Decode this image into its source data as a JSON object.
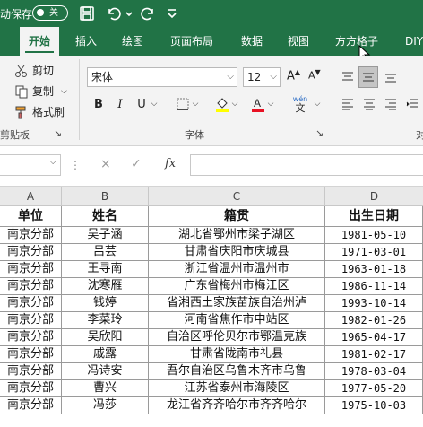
{
  "qat": {
    "autosave_label": "动保存",
    "toggle_label": "关"
  },
  "tabs": [
    "开始",
    "插入",
    "绘图",
    "页面布局",
    "数据",
    "视图",
    "方方格子",
    "DIY"
  ],
  "clipboard": {
    "cut": "剪切",
    "copy": "复制",
    "format_painter": "格式刷",
    "group": "剪贴板"
  },
  "font": {
    "name": "宋体",
    "size": "12",
    "group": "字体",
    "bold": "B",
    "italic": "I",
    "underline": "U",
    "pinyin_top": "wén",
    "pinyin_bottom": "文"
  },
  "align": {
    "group_partial": "对"
  },
  "formula": {
    "fx": "fx",
    "cancel": "×",
    "confirm": "✓"
  },
  "columns": [
    "A",
    "B",
    "C",
    "D"
  ],
  "table": {
    "headers": [
      "单位",
      "姓名",
      "籍贯",
      "出生日期"
    ],
    "rows": [
      [
        "南京分部",
        "吴子涵",
        "湖北省鄂州市梁子湖区",
        "1981-05-10"
      ],
      [
        "南京分部",
        "吕芸",
        "甘肃省庆阳市庆城县",
        "1971-03-01"
      ],
      [
        "南京分部",
        "王寻南",
        "浙江省温州市温州市",
        "1963-01-18"
      ],
      [
        "南京分部",
        "沈寒雁",
        "广东省梅州市梅江区",
        "1986-11-14"
      ],
      [
        "南京分部",
        "钱婷",
        "省湘西土家族苗族自治州泸",
        "1993-10-14"
      ],
      [
        "南京分部",
        "李菜玲",
        "河南省焦作市中站区",
        "1982-01-26"
      ],
      [
        "南京分部",
        "吴欣阳",
        "自治区呼伦贝尔市鄂温克族",
        "1965-04-17"
      ],
      [
        "南京分部",
        "戚露",
        "甘肃省陇南市礼县",
        "1981-02-17"
      ],
      [
        "南京分部",
        "冯诗安",
        "吾尔自治区乌鲁木齐市乌鲁",
        "1978-03-04"
      ],
      [
        "南京分部",
        "曹兴",
        "江苏省泰州市海陵区",
        "1977-05-20"
      ],
      [
        "南京分部",
        "冯莎",
        "龙江省齐齐哈尔市齐齐哈尔",
        "1975-10-03"
      ]
    ]
  },
  "colors": {
    "excel_green": "#217346",
    "font_color_red": "#e81123",
    "highlight_yellow": "#ffff00"
  }
}
